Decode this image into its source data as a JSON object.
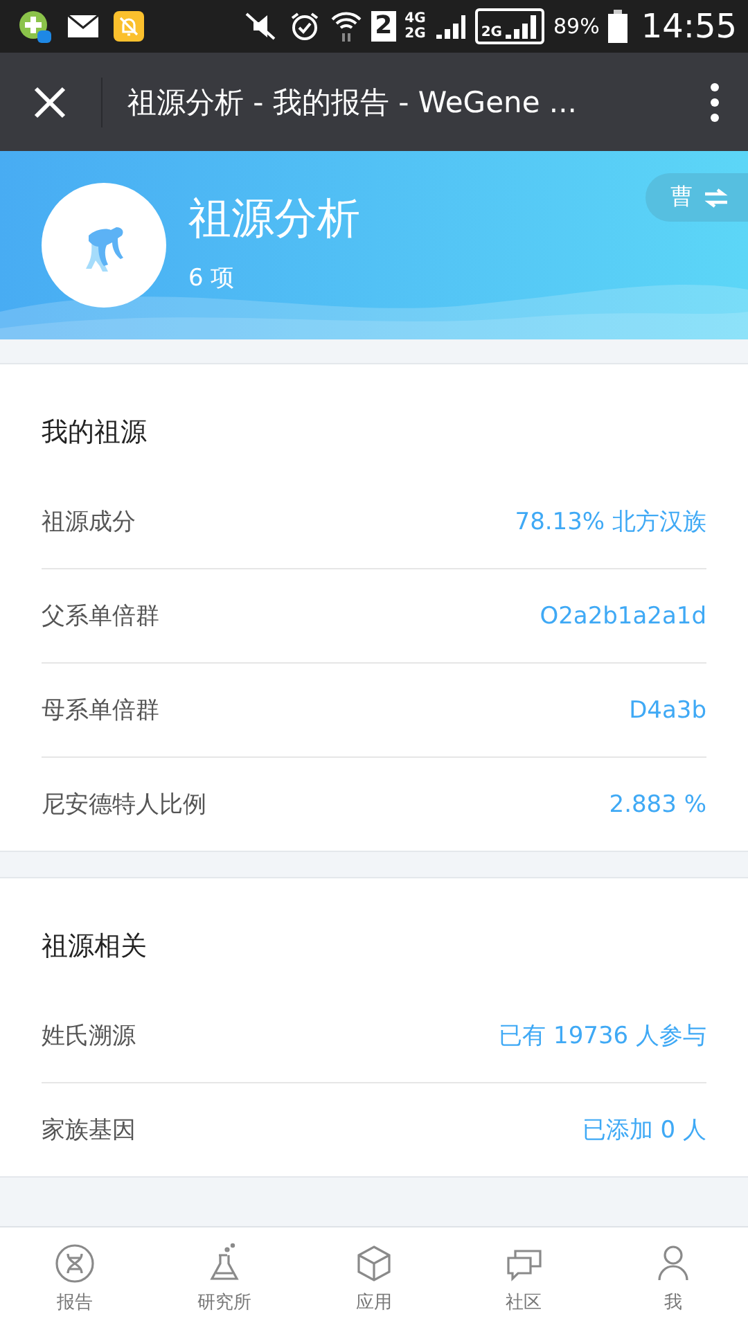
{
  "status_bar": {
    "sim_slot": "2",
    "network_upper": "4G",
    "network_lower": "2G",
    "network_active": "2G",
    "battery": "89%",
    "time": "14:55"
  },
  "app_bar": {
    "title": "祖源分析 - 我的报告 - WeGene ..."
  },
  "hero": {
    "title": "祖源分析",
    "count": "6 项",
    "switch_label": "曹"
  },
  "sections": [
    {
      "title": "我的祖源",
      "rows": [
        {
          "label": "祖源成分",
          "value": "78.13% 北方汉族"
        },
        {
          "label": "父系单倍群",
          "value": "O2a2b1a2a1d"
        },
        {
          "label": "母系单倍群",
          "value": "D4a3b"
        },
        {
          "label": "尼安德特人比例",
          "value": "2.883 %"
        }
      ]
    },
    {
      "title": "祖源相关",
      "rows": [
        {
          "label": "姓氏溯源",
          "value": "已有 19736 人参与"
        },
        {
          "label": "家族基因",
          "value": "已添加 0 人"
        }
      ]
    }
  ],
  "tab_bar": [
    {
      "kind": "dna",
      "label": "报告"
    },
    {
      "kind": "flask",
      "label": "研究所"
    },
    {
      "kind": "cube",
      "label": "应用"
    },
    {
      "kind": "chat",
      "label": "社区"
    },
    {
      "kind": "person",
      "label": "我"
    }
  ]
}
